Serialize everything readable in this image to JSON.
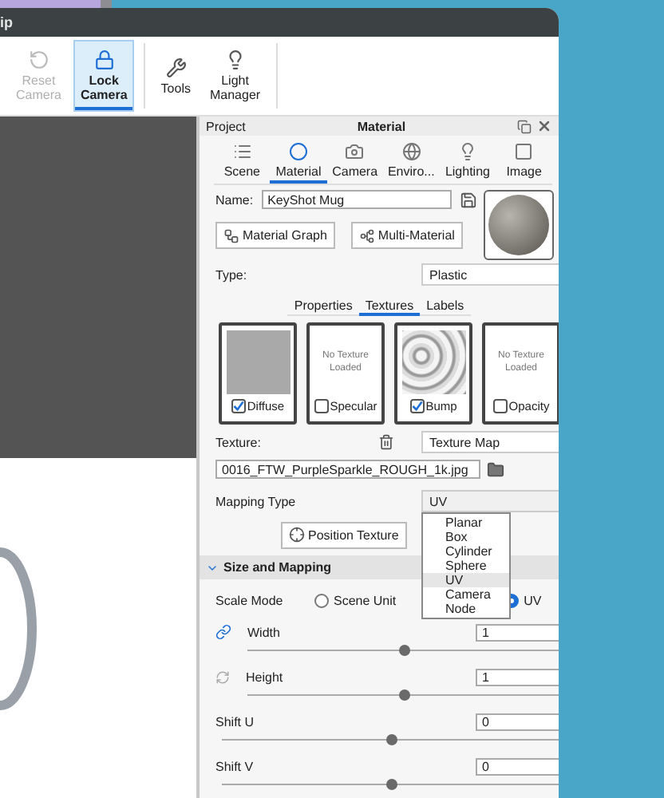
{
  "window": {
    "title": "ip"
  },
  "toolbar": {
    "camera_buttons": [
      {
        "label": "Reset Camera",
        "disabled": true,
        "selected": false
      },
      {
        "label": "Lock Camera",
        "disabled": false,
        "selected": true
      }
    ],
    "tool_buttons": [
      {
        "label": "Tools",
        "disabled": false,
        "selected": false
      },
      {
        "label": "Light Manager",
        "disabled": false,
        "selected": false
      }
    ]
  },
  "panel": {
    "header": {
      "left": "Project",
      "title": "Material"
    },
    "tabs": [
      {
        "label": "Scene",
        "selected": false
      },
      {
        "label": "Material",
        "selected": true
      },
      {
        "label": "Camera",
        "selected": false
      },
      {
        "label": "Enviro...",
        "selected": false
      },
      {
        "label": "Lighting",
        "selected": false
      },
      {
        "label": "Image",
        "selected": false
      }
    ],
    "name": {
      "label": "Name:",
      "value": "KeyShot Mug"
    },
    "buttons": [
      "Material Graph",
      "Multi-Material"
    ],
    "type": {
      "label": "Type:",
      "value": "Plastic"
    },
    "subtabs": [
      {
        "label": "Properties",
        "selected": false
      },
      {
        "label": "Textures",
        "selected": true
      },
      {
        "label": "Labels",
        "selected": false
      }
    ],
    "textures": [
      {
        "label": "Diffuse",
        "checked": true,
        "kind": "noise"
      },
      {
        "label": "Specular",
        "checked": false,
        "kind": "empty",
        "empty_text": "No Texture Loaded"
      },
      {
        "label": "Bump",
        "checked": true,
        "kind": "marble"
      },
      {
        "label": "Opacity",
        "checked": false,
        "kind": "empty",
        "empty_text": "No Texture Loaded"
      }
    ],
    "texture": {
      "label": "Texture:",
      "value": "Texture Map"
    },
    "file": "0016_FTW_PurpleSparkle_ROUGH_1k.jpg",
    "mapping": {
      "label": "Mapping Type",
      "value": "UV",
      "expanded": true,
      "options": [
        {
          "label": "Planar",
          "selected": false
        },
        {
          "label": "Box",
          "selected": false
        },
        {
          "label": "Cylinder",
          "selected": false
        },
        {
          "label": "Sphere",
          "selected": false
        },
        {
          "label": "UV",
          "selected": true
        },
        {
          "label": "Camera",
          "selected": false
        },
        {
          "label": "Node",
          "selected": false
        }
      ]
    },
    "position_button": "Position Texture",
    "section": {
      "title": "Size and Mapping",
      "expanded": true
    },
    "scale_mode": {
      "label": "Scale Mode",
      "options": [
        {
          "label": "Scene Unit",
          "selected": false
        },
        {
          "label": "UV",
          "selected": true
        }
      ]
    },
    "sliders": [
      {
        "label": "Width",
        "value": "1",
        "level": 0.5,
        "kind": "link"
      },
      {
        "label": "Height",
        "value": "1",
        "level": 0.5,
        "kind": "sync"
      },
      {
        "label": "Shift U",
        "value": "0",
        "level": 0.5,
        "kind": "plain"
      },
      {
        "label": "Shift V",
        "value": "0",
        "level": 0.5,
        "kind": "plain"
      }
    ]
  }
}
